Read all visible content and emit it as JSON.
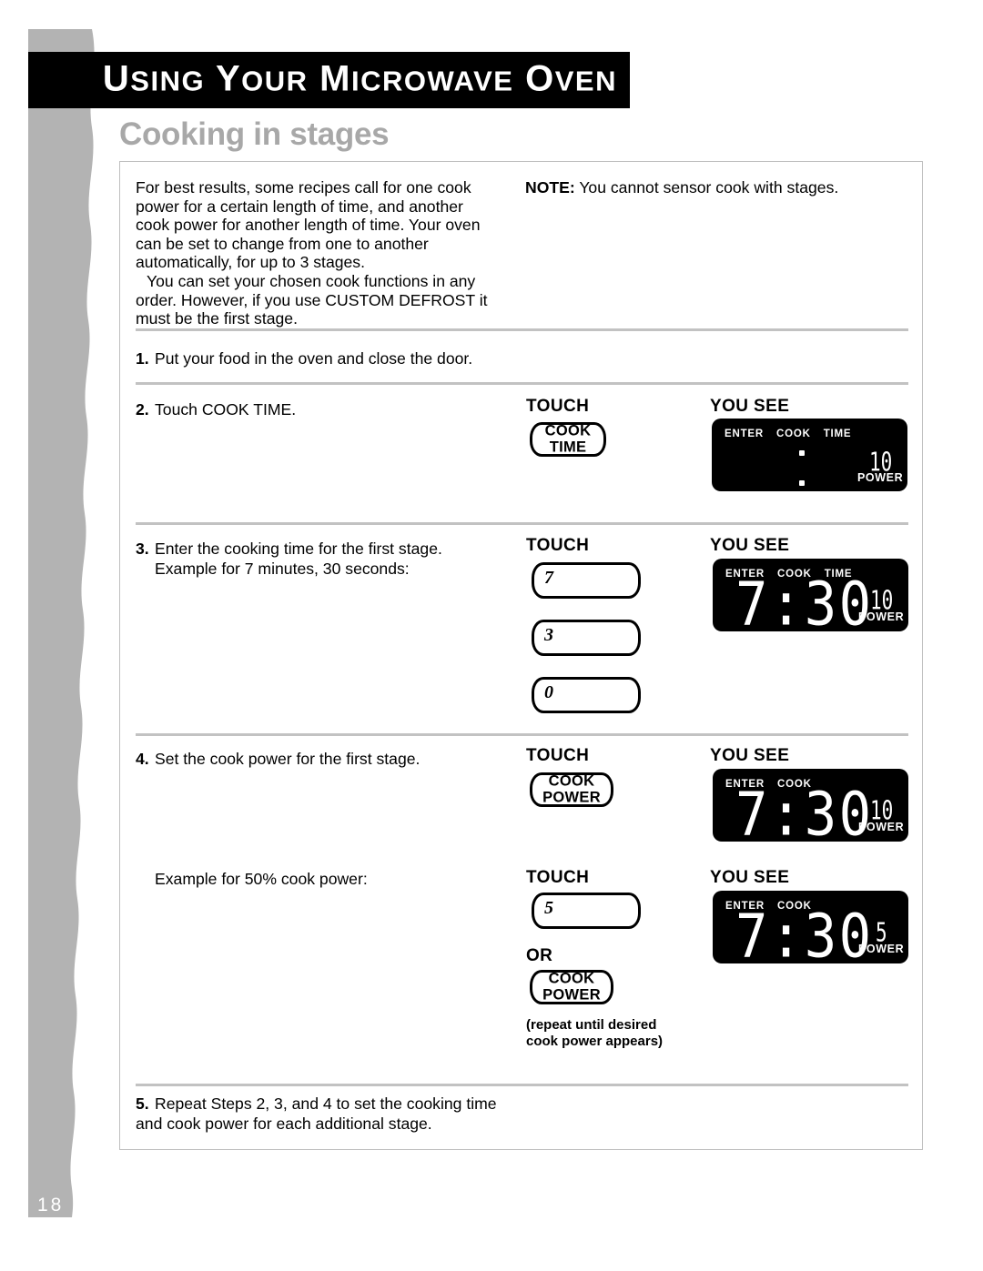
{
  "page": {
    "number": "18",
    "chapter_title": "Using Your Microwave Oven",
    "section_heading": "Cooking in stages"
  },
  "intro": {
    "paragraph1": "For best results, some recipes call for one cook power for a certain length of time, and another cook power for another length of time. Your oven can be set to change from one to another automatically, for up to 3 stages.",
    "paragraph2": "You can set your chosen cook functions in any order. However, if you use CUSTOM DEFROST it must be the first stage.",
    "note_label": "NOTE:",
    "note_text": "You cannot sensor cook with stages."
  },
  "column_headers": {
    "touch": "TOUCH",
    "you_see": "YOU SEE",
    "or": "OR"
  },
  "steps": [
    {
      "number": "1.",
      "text": "Put your food in the oven and close the door."
    },
    {
      "number": "2.",
      "text": "Touch COOK TIME."
    },
    {
      "number": "3.",
      "text": "Enter the cooking time for the first stage.",
      "continuation": "Example for 7 minutes, 30 seconds:"
    },
    {
      "number": "4.",
      "text": "Set the cook power for the first stage.",
      "continuation": "Example for 50% cook power:"
    },
    {
      "number": "5.",
      "text": "Repeat Steps 2, 3, and 4 to set the cooking time and cook power for each additional stage."
    }
  ],
  "buttons": {
    "cook_time": {
      "line1": "COOK",
      "line2": "TIME"
    },
    "cook_power": {
      "line1": "COOK",
      "line2": "POWER"
    },
    "key7": "7",
    "key3": "3",
    "key0": "0",
    "key5": "5"
  },
  "repeat_note": {
    "line1": "(repeat until desired",
    "line2": "cook power appears)"
  },
  "displays": [
    {
      "id": "display-step2",
      "labels": [
        "ENTER",
        "COOK",
        "TIME"
      ],
      "time": "",
      "colon": true,
      "power_value": "10",
      "power_label": "POWER"
    },
    {
      "id": "display-step3",
      "labels": [
        "ENTER",
        "COOK",
        "TIME"
      ],
      "time": "7:30",
      "colon": false,
      "power_value": "10",
      "power_label": "POWER"
    },
    {
      "id": "display-step4",
      "labels": [
        "ENTER",
        "COOK"
      ],
      "time": "7:30",
      "colon": false,
      "power_value": "10",
      "power_label": "POWER"
    },
    {
      "id": "display-step4b",
      "labels": [
        "ENTER",
        "COOK"
      ],
      "time": "7:30",
      "colon": false,
      "power_value": "5",
      "power_label": "POWER"
    }
  ],
  "colors": {
    "sidebar_gray": "#b3b3b3",
    "heading_gray": "#a8a8a8",
    "banner_black": "#000000",
    "border_gray": "#bfbfbf",
    "separator_gray": "#c2c2c2"
  }
}
